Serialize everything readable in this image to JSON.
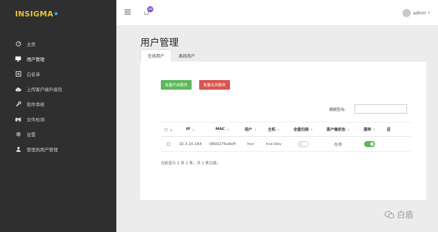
{
  "logo": {
    "text": "INSIGMA"
  },
  "sidebar": {
    "items": [
      {
        "label": "主页",
        "icon": "gauge-icon"
      },
      {
        "label": "用户管理",
        "icon": "monitor-icon"
      },
      {
        "label": "白名单",
        "icon": "list-icon"
      },
      {
        "label": "上传客户端升级包",
        "icon": "cloud-upload-icon"
      },
      {
        "label": "软件审核",
        "icon": "wrench-icon"
      },
      {
        "label": "文件检测",
        "icon": "binoculars-icon"
      },
      {
        "label": "设置",
        "icon": "gear-icon"
      },
      {
        "label": "管理员用户管理",
        "icon": "user-icon"
      }
    ],
    "active_index": 1
  },
  "topbar": {
    "badge": "99",
    "username": "admin"
  },
  "page": {
    "title": "用户管理",
    "tabs": [
      {
        "label": "在线用户"
      },
      {
        "label": "离线用户"
      }
    ],
    "active_tab": 0
  },
  "actions": {
    "enable_label": "批量开启服务",
    "disable_label": "批量关闭服务"
  },
  "search": {
    "label": "模糊查询:",
    "value": ""
  },
  "table": {
    "headers": [
      "IP",
      "MAC",
      "用户",
      "主机",
      "全盘扫描",
      "客户端状态",
      "服务",
      "应"
    ],
    "rows": [
      {
        "ip": "10.3.10.164",
        "mac": "0800275e9eff",
        "user": "hcz",
        "host": "hcz-Dev",
        "full_scan": false,
        "status": "在线",
        "service": true
      }
    ]
  },
  "footer": {
    "summary": "当前显示 1 到 1 条，共 1 条记录。"
  },
  "watermark": {
    "text": "白盾"
  },
  "colors": {
    "sidebar_bg": "#2f2f2f",
    "green": "#5cb85c",
    "red": "#d9534f",
    "logo": "#e8c23b",
    "badge": "#7a4fc0"
  }
}
